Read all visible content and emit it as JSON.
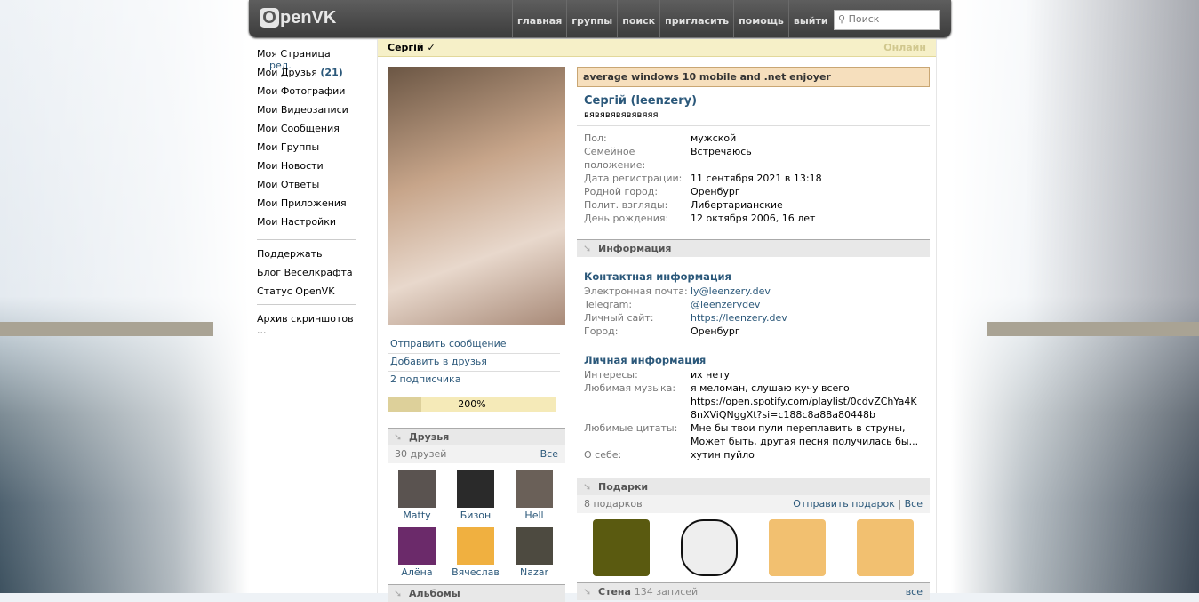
{
  "header": {
    "logo": "OpenVK",
    "logo_letter": "O",
    "logo_rest": "penVK",
    "nav": [
      "главная",
      "группы",
      "поиск",
      "пригласить",
      "помощь",
      "выйти"
    ],
    "search_placeholder": "Поиск"
  },
  "sidebar": {
    "my_page": "Моя Страница",
    "edit": "ред.",
    "friends": "Мои Друзья",
    "friends_count": "(21)",
    "items": [
      "Мои Фотографии",
      "Мои Видеозаписи",
      "Мои Сообщения",
      "Мои Группы",
      "Мои Новости",
      "Мои Ответы",
      "Мои Приложения",
      "Мои Настройки"
    ],
    "extra": [
      "Поддержать",
      "Блог Веселкрафта",
      "Статус OpenVK"
    ],
    "archive": "Архив скриншотов ..."
  },
  "profile": {
    "title": "Сергій",
    "verified": "✓",
    "online": "Онлайн",
    "status": "average windows 10 mobile and .net enjoyer",
    "full_name": "Сергій (leenzery)",
    "subtitle": "вявявявявявяяя",
    "basic": [
      {
        "k": "Пол:",
        "v": "мужской"
      },
      {
        "k": "Семейное положение:",
        "v": "Встречаюсь"
      },
      {
        "k": "Дата регистрации:",
        "v": "11 сентября 2021 в 13:18"
      },
      {
        "k": "Родной город:",
        "v": "Оренбург"
      },
      {
        "k": "Полит. взгляды:",
        "v": "Либертарианские"
      },
      {
        "k": "День рождения:",
        "v": "12 октября 2006, 16 лет"
      }
    ],
    "info_header": "Информация",
    "contact_header": "Контактная информация",
    "contact": [
      {
        "k": "Электронная почта:",
        "v": "ly@leenzery.dev"
      },
      {
        "k": "Telegram:",
        "v": "@leenzerydev"
      },
      {
        "k": "Личный сайт:",
        "v": "https://leenzery.dev"
      },
      {
        "k": "Город:",
        "v": "Оренбург"
      }
    ],
    "personal_header": "Личная информация",
    "personal": [
      {
        "k": "Интересы:",
        "v": "их нету"
      },
      {
        "k": "Любимая музыка:",
        "v": "я меломан, слушаю кучу всего https://open.spotify.com/playlist/0cdvZChYa4K8nXViQNggXt?si=c188c8a88a80448b"
      },
      {
        "k": "Любимые цитаты:",
        "v": "Мне бы твои пули переплавить в струны, Может быть, другая песня получилась бы..."
      },
      {
        "k": "О себе:",
        "v": "хутин пуйло"
      }
    ],
    "actions": [
      "Отправить сообщение",
      "Добавить в друзья",
      "2 подписчика"
    ],
    "rating": "200%",
    "rating_fill": 0.2
  },
  "friends": {
    "header": "Друзья",
    "count": "30 друзей",
    "all": "Все",
    "list": [
      {
        "name": "Matty",
        "color": "#5a5350"
      },
      {
        "name": "Бизон",
        "color": "#2a2a2a"
      },
      {
        "name": "Hell",
        "color": "#6a6058"
      },
      {
        "name": "Алёна",
        "color": "#6b2a6a"
      },
      {
        "name": "Вячеслав",
        "color": "#f0b040"
      },
      {
        "name": "Nazar",
        "color": "#4d4a40"
      }
    ]
  },
  "albums": {
    "header": "Альбомы"
  },
  "gifts": {
    "header": "Подарки",
    "count": "8 подарков",
    "send": "Отправить подарок",
    "sep": "|",
    "all": "Все",
    "items": [
      {
        "name": "jar",
        "color": "#5a5a10"
      },
      {
        "name": "trollface",
        "color": "#eeeeee"
      },
      {
        "name": "box",
        "color": "#f2c070"
      },
      {
        "name": "box",
        "color": "#f2c070"
      }
    ]
  },
  "wall": {
    "header": "Стена",
    "count": "134 записей",
    "all": "все"
  }
}
